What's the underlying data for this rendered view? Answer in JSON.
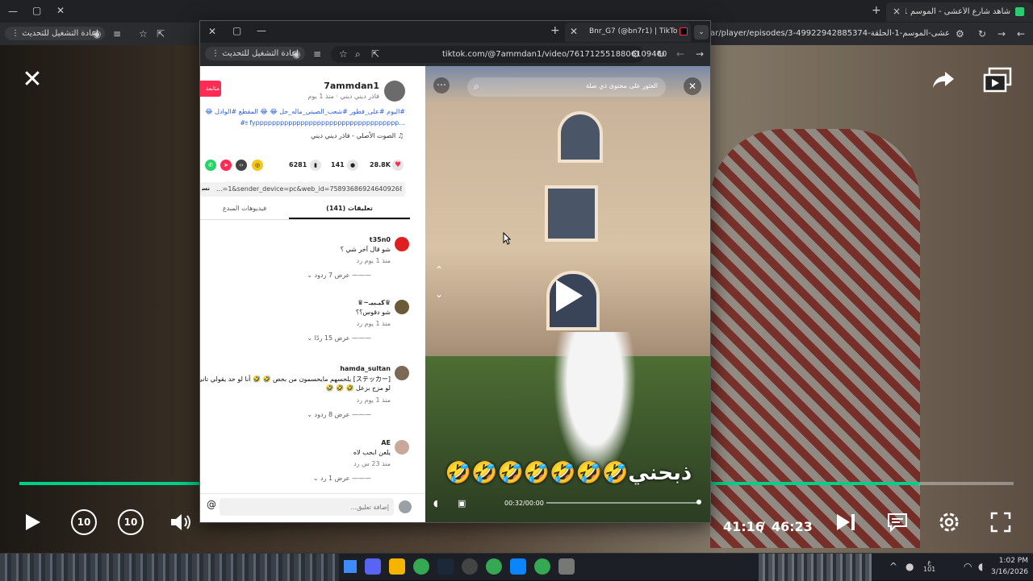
{
  "bg_browser": {
    "tab_title": "شاهد شارع الأعشى - الموسم 1 /",
    "close_tab": "×",
    "new_tab": "+",
    "url": "ar/player/episodes/3-شارع-الأعشى-الموسم-1-الحلقة-49922942885374",
    "restart_update": "إعادة التشغيل للتحديث"
  },
  "player": {
    "current_time": "41:16",
    "separator": "/",
    "duration": "46:23",
    "progress_fraction": 0.905,
    "skip_back_label": "10",
    "skip_fwd_label": "10"
  },
  "popup": {
    "tab_title": "Bnr_G7 (@bn7r1) | TikTok(24)",
    "url": "tiktok.com/@7ammdan1/video/7617125518806109460",
    "restart_update": "إعادة التشغيل للتحديث",
    "profile": {
      "username": "7ammdan1",
      "meta": "فاذر ديني ديني · منذ 1 يوم",
      "follow": "متابعة",
      "caption_line1": "#اليوم #على_فطور #شعب_الصيني_ماله_حل 😂 😂 المقطع #الوادل 😂 😂",
      "caption_line2": "#ײַ fyppppppppppppppppppppppppppppppppppp...",
      "sound": "الصوت الأصلي - فاذر ديني ديني"
    },
    "stats": {
      "likes": "28.8K",
      "comments": "141",
      "saves": "6281"
    },
    "share_link": "...=1&sender_device=pc&web_id=7589368692464092688",
    "copy_label": "نسخ",
    "tabs": {
      "comments": "تعليقات (141)",
      "creator_videos": "فيديوهات المبدع"
    },
    "comments": [
      {
        "name": "t35n0",
        "text": "شو قال آخر شي ؟",
        "meta": "منذ 1 يوم  رد",
        "replies": "عرض 7 ردود"
      },
      {
        "name": "♛كيـبيـ~♛",
        "text": "شو دقوس؟؟",
        "meta": "منذ 1 يوم  رد",
        "replies": "عرض 15 ردًا"
      },
      {
        "name": "hamda_sultan",
        "text": "[ステッカー] يلحسهم مايحسمون من بحص 🤣 🤣 أنا لو حد يقولي تاني حسيت",
        "text2": "لو مزح بزعل 🤣 🤣 🤣",
        "meta": "منذ 1 يوم  رد",
        "replies": "عرض 8 ردود"
      },
      {
        "name": "AE",
        "text": "يلعن ابحب لاه",
        "meta": "منذ 23 س  رد",
        "replies": "عرض 1 رد"
      }
    ],
    "comment_placeholder": "إضافة تعليق...",
    "mention": "@",
    "video": {
      "search_text": "العثور على محتوى ذي صلة",
      "overlay_caption": "ذبحني🤣🤣🤣🤣🤣🤣🤣",
      "time": "00:32/00:00"
    }
  },
  "taskbar": {
    "time": "1:02 PM",
    "date": "3/16/2026",
    "lang": "ع\n101"
  }
}
